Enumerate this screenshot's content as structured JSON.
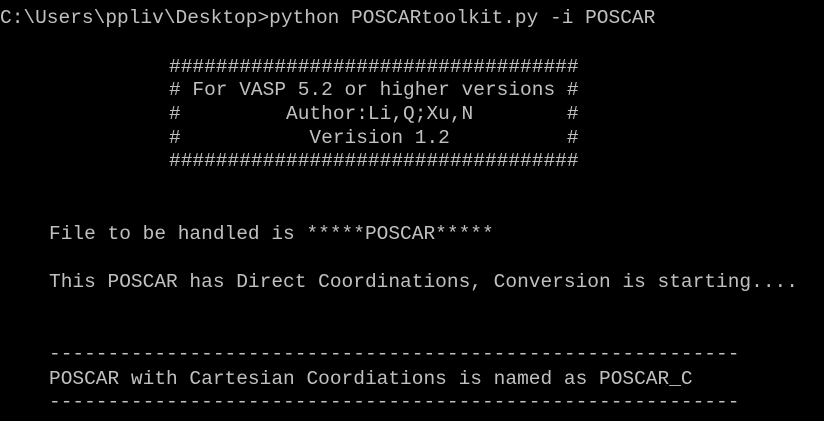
{
  "terminal": {
    "text_color": "#c0c0c0",
    "background_color": "#000000",
    "command_line": "C:\\Users\\ppliv\\Desktop>python POSCARtoolkit.py -i POSCAR",
    "banner": {
      "border_top": "###################################",
      "line1": "# For VASP 5.2 or higher versions #",
      "line2": "#         Author:Li,Q;Xu,N        #",
      "line3": "#           Verision 1.2          #",
      "border_bottom": "###################################"
    },
    "file_message": "File to be handled is *****POSCAR*****",
    "conversion_message": "This POSCAR has Direct Coordinations, Conversion is starting....",
    "separator_top": "-----------------------------------------------------------",
    "result_message": "POSCAR with Cartesian Coordiations is named as POSCAR_C",
    "separator_bottom": "-----------------------------------------------------------"
  }
}
